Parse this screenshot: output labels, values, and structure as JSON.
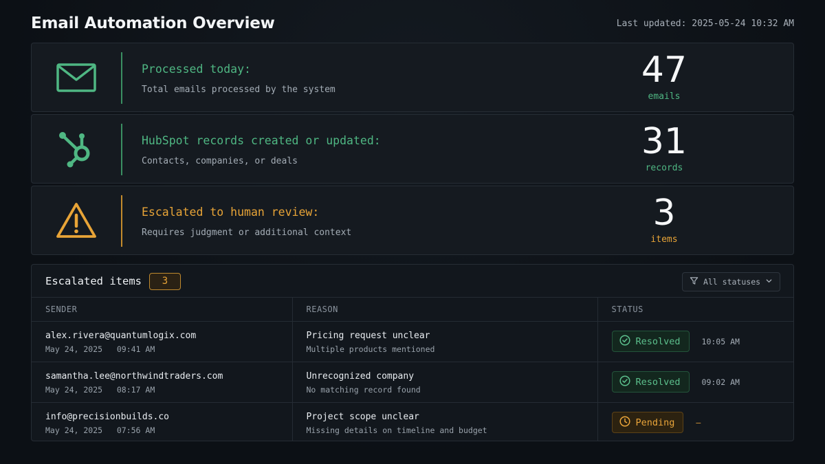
{
  "header": {
    "title": "Email Automation Overview",
    "last_updated": "Last updated: 2025-05-24 10:32 AM"
  },
  "cards": [
    {
      "icon": "mail-icon",
      "label": "Processed today:",
      "description": "Total emails processed by the system",
      "value": "47",
      "unit": "emails",
      "accent": "#4fb783"
    },
    {
      "icon": "hubspot-icon",
      "label": "HubSpot records created or updated:",
      "description": "Contacts, companies, or deals",
      "value": "31",
      "unit": "records",
      "accent": "#4fb783"
    },
    {
      "icon": "warning-icon",
      "label": "Escalated to human review:",
      "description": "Requires judgment or additional context",
      "value": "3",
      "unit": "items",
      "accent": "#e8a437"
    }
  ],
  "escalated": {
    "title": "Escalated items",
    "count": "3",
    "filter_label": "All statuses",
    "columns": [
      "SENDER",
      "REASON",
      "STATUS"
    ],
    "rows": [
      {
        "sender": "alex.rivera@quantumlogix.com",
        "date": "May 24, 2025   09:41 AM",
        "reason": "Pricing request unclear",
        "reason_detail": "Multiple products mentioned",
        "status": "Resolved",
        "status_time": "10:05 AM"
      },
      {
        "sender": "samantha.lee@northwindtraders.com",
        "date": "May 24, 2025   08:17 AM",
        "reason": "Unrecognized company",
        "reason_detail": "No matching record found",
        "status": "Resolved",
        "status_time": "09:02 AM"
      },
      {
        "sender": "info@precisionbuilds.co",
        "date": "May 24, 2025   07:56 AM",
        "reason": "Project scope unclear",
        "reason_detail": "Missing details on timeline and budget",
        "status": "Pending",
        "status_time": "—"
      }
    ]
  },
  "colors": {
    "green": "#4fb783",
    "amber": "#e8a437",
    "background": "#0d1117"
  }
}
